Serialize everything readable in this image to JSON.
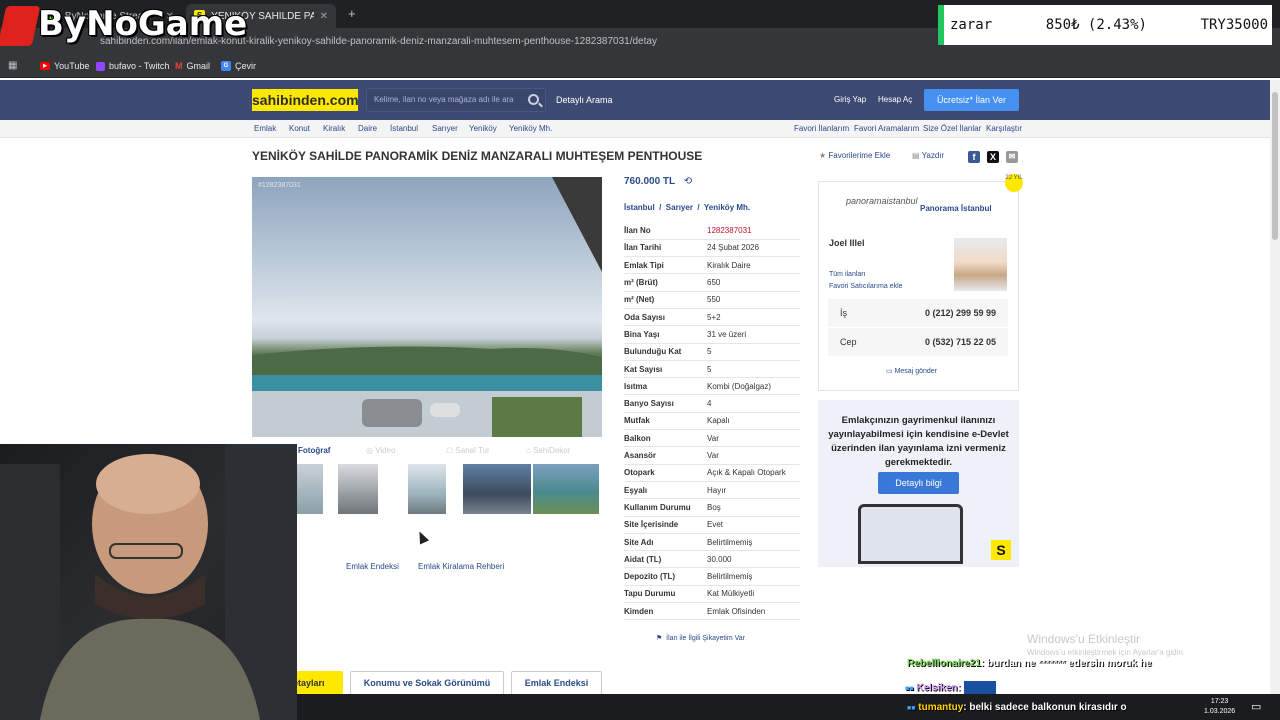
{
  "browser": {
    "tabs": [
      {
        "label": "ByNoGame Stream - Watch Live"
      },
      {
        "label": "YENİKÖY SAHİLDE PANORAMİK"
      }
    ],
    "url": "sahibinden.com/ilan/emlak-konut-kiralik-yenikoy-sahilde-panoramik-deniz-manzarali-muhtesem-penthouse-1282387031/detay",
    "bookmarks": [
      "YouTube",
      "bufavo - Twitch",
      "Gmail",
      "Çevir"
    ]
  },
  "overlay": {
    "logo_text": "ByNoGame",
    "ticker": {
      "label": "zarar",
      "change": "850₺ (2.43%)",
      "target": "TRY35000"
    }
  },
  "header": {
    "logo": "sahibinden.com",
    "search_placeholder": "Kelime, ilan no veya mağaza adı ile ara",
    "detailed_search": "Detaylı Arama",
    "login": "Giriş Yap",
    "register": "Hesap Aç",
    "post_ad": "Ücretsiz* İlan Ver"
  },
  "breadcrumb": [
    "Emlak",
    "Konut",
    "Kiralık",
    "Daire",
    "İstanbul",
    "Sarıyer",
    "Yeniköy",
    "Yeniköy Mh."
  ],
  "breadcrumb_links": [
    "Favori İlanlarım",
    "Favori Aramalarım",
    "Size Özel İlanlar",
    "Karşılaştır"
  ],
  "listing": {
    "title": "YENİKÖY SAHİLDE PANORAMİK DENİZ MANZARALI MUHTEŞEM PENTHOUSE",
    "add_favorite": "Favorilerime Ekle",
    "print": "Yazdır",
    "photo_id": "#1282387031",
    "price": "760.000 TL",
    "location": [
      "İstanbul",
      "Sarıyer",
      "Yeniköy Mh."
    ],
    "gallery_tabs": [
      "Fotoğraf",
      "Video",
      "Sanal Tur",
      "SahiDekor"
    ],
    "details": [
      {
        "k": "İlan No",
        "v": "1282387031"
      },
      {
        "k": "İlan Tarihi",
        "v": "24 Şubat 2026"
      },
      {
        "k": "Emlak Tipi",
        "v": "Kiralık Daire"
      },
      {
        "k": "m² (Brüt)",
        "v": "650"
      },
      {
        "k": "m² (Net)",
        "v": "550"
      },
      {
        "k": "Oda Sayısı",
        "v": "5+2"
      },
      {
        "k": "Bina Yaşı",
        "v": "31 ve üzeri"
      },
      {
        "k": "Bulunduğu Kat",
        "v": "5"
      },
      {
        "k": "Kat Sayısı",
        "v": "5"
      },
      {
        "k": "Isıtma",
        "v": "Kombi (Doğalgaz)"
      },
      {
        "k": "Banyo Sayısı",
        "v": "4"
      },
      {
        "k": "Mutfak",
        "v": "Kapalı"
      },
      {
        "k": "Balkon",
        "v": "Var"
      },
      {
        "k": "Asansör",
        "v": "Var"
      },
      {
        "k": "Otopark",
        "v": "Açık & Kapalı Otopark"
      },
      {
        "k": "Eşyalı",
        "v": "Hayır"
      },
      {
        "k": "Kullanım Durumu",
        "v": "Boş"
      },
      {
        "k": "Site İçerisinde",
        "v": "Evet"
      },
      {
        "k": "Site Adı",
        "v": "Belirtilmemiş"
      },
      {
        "k": "Aidat (TL)",
        "v": "30.000"
      },
      {
        "k": "Depozito (TL)",
        "v": "Belirtilmemiş"
      },
      {
        "k": "Tapu Durumu",
        "v": "Kat Mülkiyetli"
      },
      {
        "k": "Kimden",
        "v": "Emlak Ofisinden"
      }
    ],
    "report": "İlan ile İlgili Şikayetim Var",
    "bottom_links": [
      "Emlak Endeksi",
      "Emlak Kiralama Rehberi"
    ],
    "bottom_tabs": [
      "İlan Detayları",
      "Konumu ve Sokak Görünümü",
      "Emlak Endeksi"
    ]
  },
  "seller": {
    "badge": "22 YIL",
    "agency_logo": "panoramaistanbul",
    "agency": "Panorama İstanbul",
    "agent": "Joel Illel",
    "all_listings": "Tüm ilanları",
    "add_favorite_seller": "Favori Satıcılarıma ekle",
    "phones": [
      {
        "label": "İş",
        "number": "0 (212) 299 59 99"
      },
      {
        "label": "Cep",
        "number": "0 (532) 715 22 05"
      }
    ],
    "message": "Mesaj gönder"
  },
  "ad": {
    "text": "Emlakçınızın gayrimenkul ilanınızı yayınlayabilmesi için kendisine e-Devlet üzerinden ilan yayınlama izni vermeniz gerekmektedir.",
    "button": "Detaylı bilgi"
  },
  "windows": {
    "activate_title": "Windows'u Etkinleştir",
    "activate_sub": "Windows'u etkinleştirmek için Ayarlar'a gidin.",
    "time": "17:23",
    "date": "1.03.2026"
  },
  "chat": [
    {
      "user": "Rebellionaire21",
      "msg": ": burdan ne *******  edersin moruk he"
    },
    {
      "user": "Kelsiken",
      "msg": ":"
    },
    {
      "user": "tumantuy",
      "msg": ": belki sadece balkonun kirasıdır o"
    }
  ]
}
